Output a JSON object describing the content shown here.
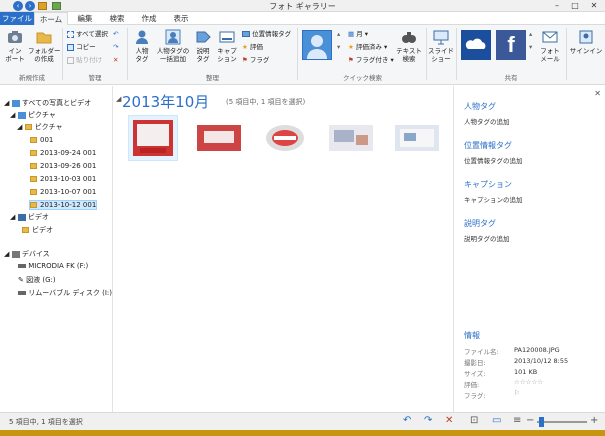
{
  "window": {
    "title": "フォト ギャラリー",
    "minimize": "–",
    "maximize": "□",
    "close": "✕"
  },
  "tabs": [
    "ファイル",
    "ホーム",
    "編集",
    "検索",
    "作成",
    "表示"
  ],
  "ribbon": {
    "groups": {
      "new": "新規作成",
      "manage": "管理",
      "organize": "整理",
      "quick_find": "クイック検索",
      "share": "共有"
    },
    "import": "イン\nポート",
    "folder": "フォルダー\nの作成",
    "select_all": "すべて選択",
    "copy": "コピー",
    "paste": "貼り付け",
    "people_tag": "人物\nタグ",
    "people_batch": "人物タグの\n一括追加",
    "caption_tag": "説明\nタグ",
    "caption": "キャプ\nション",
    "geo_tag": "位置情報タグ",
    "rating": "評価",
    "flag": "フラグ",
    "month": "月",
    "rated": "評価済み",
    "flagged": "フラグ付き",
    "text_search": "テキスト\n検索",
    "slideshow": "スライド\nショー",
    "photo_mail": "フォト\nメール",
    "signin": "サインイン"
  },
  "tree": {
    "all": "すべての写真とビデオ",
    "pictures": "ピクチャ",
    "pictures2": "ピクチャ",
    "folders": [
      "001",
      "2013-09-24 001",
      "2013-09-26 001",
      "2013-10-03 001",
      "2013-10-07 001",
      "2013-10-12 001"
    ],
    "video": "ビデオ",
    "video2": "ビデオ",
    "devices": "デバイス",
    "drives": [
      "MICRODIA FK (F:)",
      "図液 (G:)",
      "リムーバブル ディスク (I:)"
    ]
  },
  "main": {
    "month_title": "2013年10月",
    "subtitle": "(5 項目中, 1 項目を選択)"
  },
  "details": {
    "people_tag": "人物タグ",
    "people_add": "人物タグの追加",
    "geo_tag": "位置情報タグ",
    "geo_add": "位置情報タグの追加",
    "caption": "キャプション",
    "caption_add": "キャプションの追加",
    "desc_tag": "説明タグ",
    "desc_add": "説明タグの追加",
    "info": "情報",
    "k_filename": "ファイル名:",
    "v_filename": "PA120008.JPG",
    "k_date": "撮影日:",
    "v_date": "2013/10/12  8:55",
    "k_size": "サイズ:",
    "v_size": "101 KB",
    "k_rating": "評価:",
    "v_rating": "☆☆☆☆☆",
    "k_flag": "フラグ:",
    "v_flag": "⚐"
  },
  "status": {
    "text": "5 項目中, 1 項目を選択"
  },
  "colors": {
    "accent": "#2b6fc9",
    "onedrive": "#1b4f9e",
    "facebook": "#3b5998"
  }
}
